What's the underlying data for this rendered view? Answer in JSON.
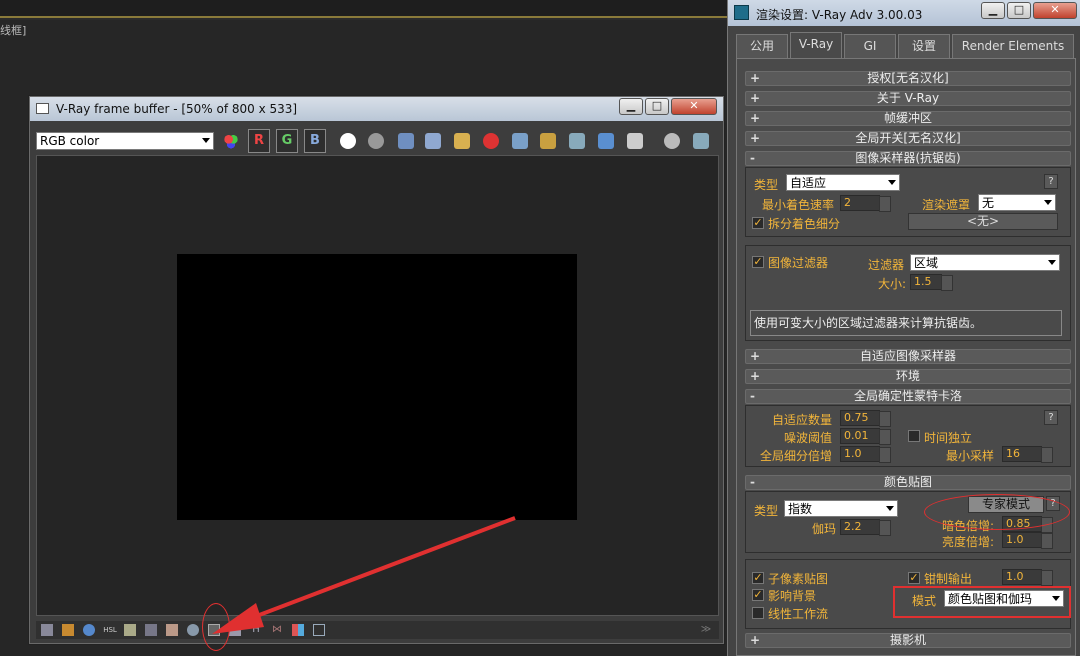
{
  "background": {
    "cut_text": "线框]"
  },
  "frame_buffer": {
    "title": "V-Ray frame buffer - [50% of 800 x 533]",
    "channel_select": "RGB color",
    "channels": {
      "r": "R",
      "g": "G",
      "b": "B"
    },
    "bottom_icons": [
      "window-icon",
      "list-icon",
      "info-icon",
      "hsl-icon",
      "levels-icon",
      "histogram-icon",
      "curve-icon",
      "lut-icon",
      "color-correction-icon",
      "lens-icon",
      "h-icon",
      "stereo-icon",
      "swatch-icon",
      "pin-icon"
    ],
    "bottom_labels": {
      "hsl": "HSL",
      "h": "H"
    }
  },
  "render_setup": {
    "title": "渲染设置: V-Ray Adv 3.00.03",
    "tabs": [
      "公用",
      "V-Ray",
      "GI",
      "设置",
      "Render Elements"
    ],
    "active_tab": "V-Ray",
    "rollouts": {
      "authorization": "授权[无名汉化]",
      "about": "关于 V-Ray",
      "frame_buffer": "帧缓冲区",
      "global_switches": "全局开关[无名汉化]",
      "image_sampler": "图像采样器(抗锯齿)",
      "adaptive_sampler": "自适应图像采样器",
      "environment": "环境",
      "global_dmc": "全局确定性蒙特卡洛",
      "color_mapping": "颜色贴图",
      "camera": "摄影机"
    },
    "image_sampler": {
      "type_label": "类型",
      "type_value": "自适应",
      "min_shading_label": "最小着色速率",
      "min_shading_value": "2",
      "mask_label": "渲染遮罩",
      "mask_value": "无",
      "divide_label": "拆分着色细分",
      "none_button": "<无>",
      "help": "?"
    },
    "image_filter": {
      "enable_label": "图像过滤器",
      "filter_label": "过滤器",
      "filter_value": "区域",
      "size_label": "大小:",
      "size_value": "1.5",
      "description": "使用可变大小的区域过滤器来计算抗锯齿。"
    },
    "dmc": {
      "adaptive_amount_label": "自适应数量",
      "adaptive_amount_value": "0.75",
      "noise_threshold_label": "噪波阈值",
      "noise_threshold_value": "0.01",
      "time_independent_label": "时间独立",
      "global_subdiv_label": "全局细分倍增",
      "global_subdiv_value": "1.0",
      "min_samples_label": "最小采样",
      "min_samples_value": "16",
      "help": "?"
    },
    "color_mapping": {
      "type_label": "类型",
      "type_value": "指数",
      "expert_button": "专家模式",
      "help": "?",
      "dark_label": "暗色倍增:",
      "dark_value": "0.85",
      "gamma_label": "伽玛",
      "gamma_value": "2.2",
      "bright_label": "亮度倍增:",
      "bright_value": "1.0",
      "subpixel_label": "子像素贴图",
      "clamp_label": "钳制输出",
      "clamp_value": "1.0",
      "affect_bg_label": "影响背景",
      "mode_label": "模式",
      "mode_value": "颜色贴图和伽玛",
      "linear_label": "线性工作流"
    },
    "colors": {
      "label": "#f2b53a",
      "annotation": "#e03030"
    }
  }
}
